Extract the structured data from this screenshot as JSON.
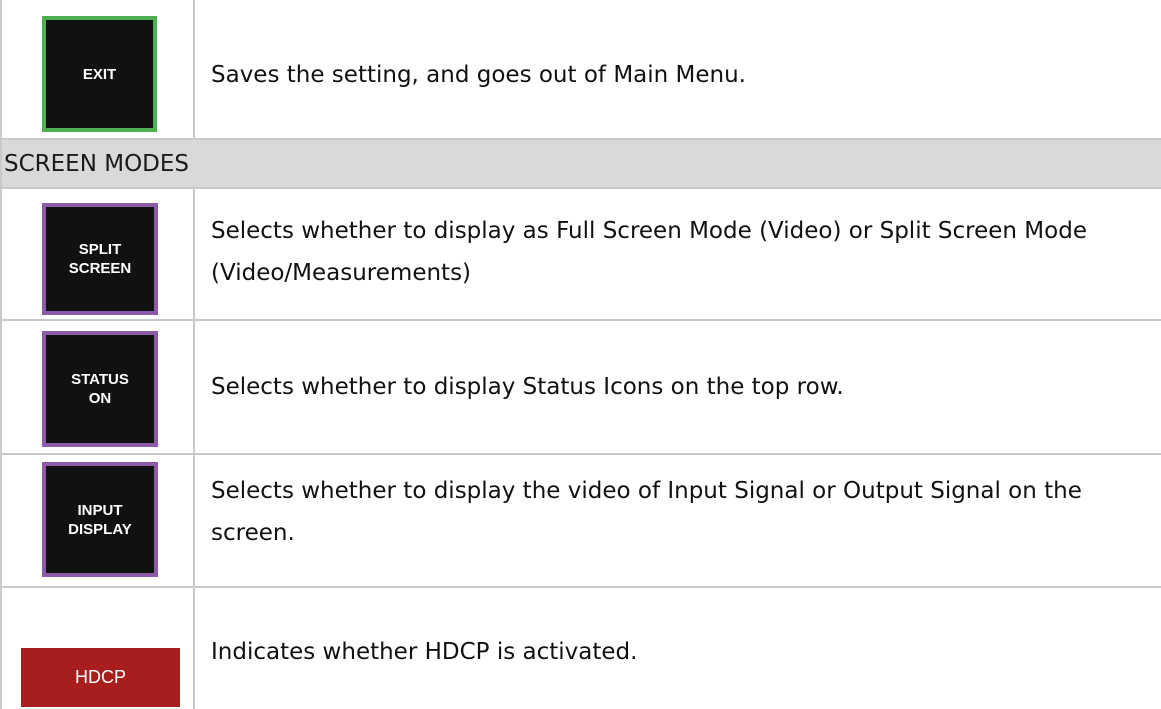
{
  "rows": [
    {
      "icon_label": "EXIT",
      "description": "Saves the setting, and goes out of Main Menu."
    }
  ],
  "section": {
    "title": "SCREEN MODES"
  },
  "screen_modes": [
    {
      "icon_label": "SPLIT\nSCREEN",
      "description": "Selects whether to display as Full Screen Mode (Video) or Split Screen Mode (Video/Measurements)"
    },
    {
      "icon_label": "STATUS\nON",
      "description": "Selects whether to display Status Icons on the top row."
    },
    {
      "icon_label": "INPUT\nDISPLAY",
      "description": "Selects whether to display the video of Input Signal or Output Signal on the screen."
    },
    {
      "icon_label": "HDCP",
      "description": "Indicates whether HDCP is activated."
    }
  ],
  "colors": {
    "exit_border": "#4caf50",
    "mode_border": "#8e5ba8",
    "hdcp_bg": "#a81e1e",
    "header_bg": "#d9d9d9",
    "grid": "#c9c9c9"
  }
}
